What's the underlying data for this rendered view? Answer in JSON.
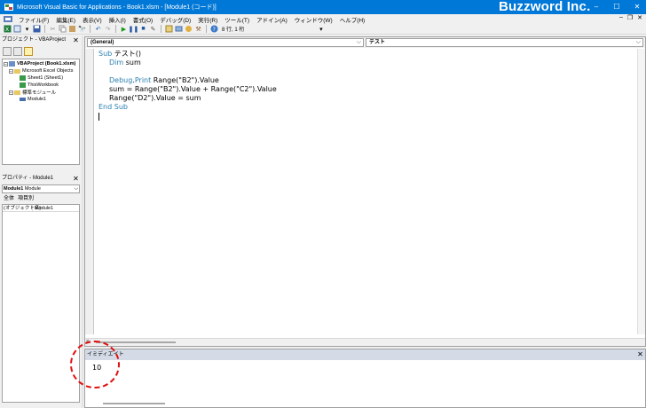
{
  "window": {
    "title": "Microsoft Visual Basic for Applications - Book1.xlsm - [Module1 (コード)]",
    "brand": "Buzzword Inc.",
    "controls": {
      "minimize": "–",
      "maximize": "☐",
      "close": "✕"
    },
    "mdi_controls": {
      "minimize": "–",
      "restore": "❐",
      "close": "✕"
    }
  },
  "menu": {
    "items": [
      "ファイル(F)",
      "編集(E)",
      "表示(V)",
      "挿入(I)",
      "書式(O)",
      "デバッグ(D)",
      "実行(R)",
      "ツール(T)",
      "アドイン(A)",
      "ウィンドウ(W)",
      "ヘルプ(H)"
    ]
  },
  "toolbar": {
    "position_text": "8 行, 1 桁",
    "icons": [
      "excel-icon",
      "insert-module-icon",
      "save-icon",
      "cut-icon",
      "copy-icon",
      "paste-icon",
      "find-icon",
      "undo-icon",
      "redo-icon",
      "run-icon",
      "break-icon",
      "reset-icon",
      "design-mode-icon",
      "project-explorer-icon",
      "properties-icon",
      "object-browser-icon",
      "toolbox-icon",
      "help-icon"
    ]
  },
  "project_pane": {
    "title": "プロジェクト - VBAProject",
    "close": "✕",
    "tree": {
      "project": "VBAProject (Book1.xlsm)",
      "excel_objects_folder": "Microsoft Excel Objects",
      "sheet1": "Sheet1 (Sheet1)",
      "workbook": "ThisWorkbook",
      "modules_folder": "標準モジュール",
      "module1": "Module1"
    }
  },
  "properties_pane": {
    "title": "プロパティ - Module1",
    "close": "✕",
    "object_bold": "Module1",
    "object_type": "Module",
    "tabs": [
      "全体",
      "項目別"
    ],
    "rows": [
      {
        "key": "(オブジェクト名)",
        "value": "Module1"
      }
    ]
  },
  "code_window": {
    "object_combo": "(General)",
    "proc_combo": "テスト",
    "lines": {
      "l1_kw": "Sub",
      "l1_rest": " テスト()",
      "l2_kw": "Dim",
      "l2_rest": " sum",
      "l4_a": "Debug",
      "l4_b": ".",
      "l4_c": "Print",
      "l4_d": " Range(\"B2\").Value",
      "l5": "sum = Range(\"B2\").Value + Range(\"C2\").Value",
      "l6": "Range(\"D2\").Value = sum",
      "l7": "End Sub"
    },
    "colors": {
      "keyword": "#00008b",
      "keyword_light": "#2a7fb0"
    }
  },
  "immediate_window": {
    "title": "イミディエイト",
    "close": "✕",
    "output": "10"
  },
  "annotation": {
    "color": "#e01010"
  }
}
